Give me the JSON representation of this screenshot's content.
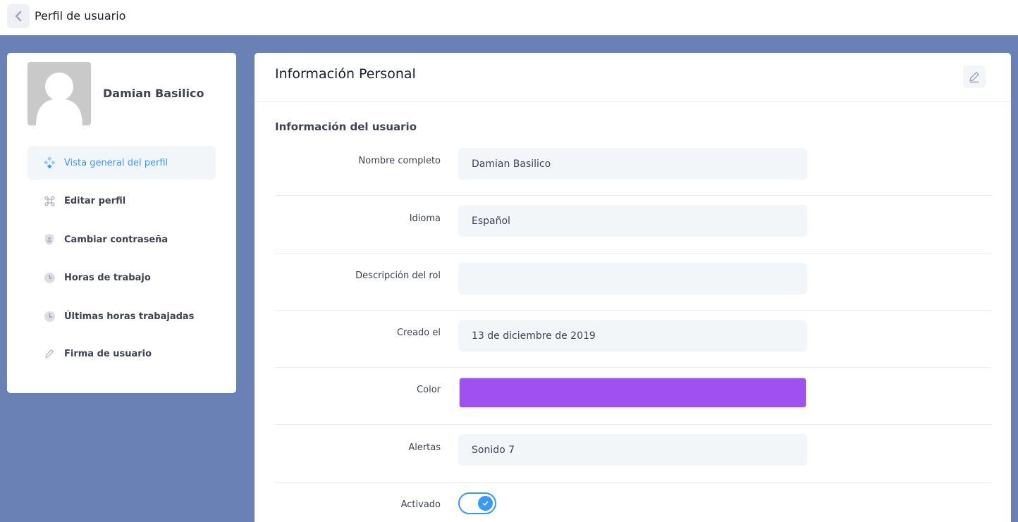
{
  "header": {
    "title": "Perfil de usuario",
    "back_icon": "chevron-left-icon"
  },
  "profile": {
    "name": "Damian Basilico",
    "avatar_icon": "user-silhouette-icon"
  },
  "nav": {
    "items": [
      {
        "label": "Vista general del perfil",
        "icon": "diamond-grid-icon",
        "active": true
      },
      {
        "label": "Editar perfil",
        "icon": "command-icon",
        "active": false
      },
      {
        "label": "Cambiar contraseña",
        "icon": "shield-user-icon",
        "active": false
      },
      {
        "label": "Horas de trabajo",
        "icon": "clock-icon",
        "active": false
      },
      {
        "label": "Últimas horas trabajadas",
        "icon": "clock-icon",
        "active": false
      },
      {
        "label": "Firma de usuario",
        "icon": "pen-icon",
        "active": false
      }
    ]
  },
  "main": {
    "title": "Información Personal",
    "section_title": "Información del usuario",
    "fields": {
      "full_name": {
        "label": "Nombre completo",
        "value": "Damian Basilico"
      },
      "language": {
        "label": "Idioma",
        "value": "Español"
      },
      "role_description": {
        "label": "Descripción del rol",
        "value": ""
      },
      "created": {
        "label": "Creado el",
        "value": "13 de diciembre de 2019"
      },
      "color": {
        "label": "Color",
        "value": "#a050f0"
      },
      "alerts": {
        "label": "Alertas",
        "value": "Sonido 7"
      },
      "active": {
        "label": "Activado",
        "value": true
      }
    }
  },
  "colors": {
    "accent": "#3699ff",
    "background": "#6a81b5",
    "user_color": "#a050f0"
  }
}
